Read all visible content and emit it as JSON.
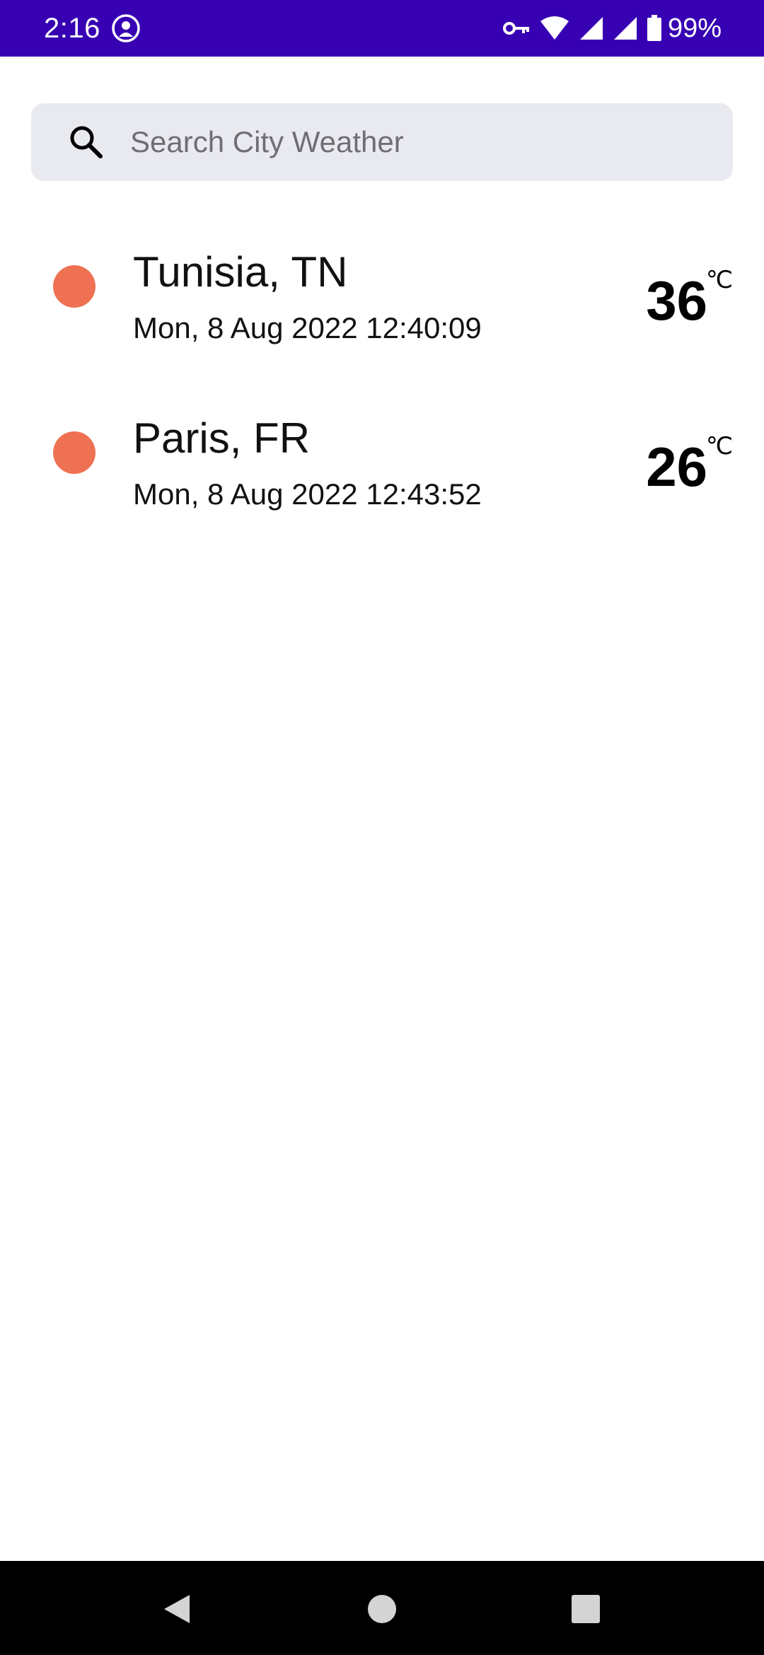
{
  "status_bar": {
    "time": "2:16",
    "battery": "99%",
    "app_icon": "app-notification-icon",
    "icons": [
      "vpn-key-icon",
      "wifi-icon",
      "signal-icon",
      "signal-icon",
      "battery-icon"
    ],
    "color": "#3700b3"
  },
  "search": {
    "placeholder": "Search City Weather",
    "value": "",
    "icon": "search-icon"
  },
  "cities": [
    {
      "name": "Tunisia, TN",
      "date": "Mon, 8 Aug 2022 12:40:09",
      "temp": "36",
      "unit": "℃",
      "dot_color": "#ef7153"
    },
    {
      "name": "Paris, FR",
      "date": "Mon, 8 Aug 2022 12:43:52",
      "temp": "26",
      "unit": "℃",
      "dot_color": "#ef7153"
    }
  ],
  "nav_bar": {
    "buttons": [
      "back-icon",
      "home-icon",
      "recents-icon"
    ]
  }
}
